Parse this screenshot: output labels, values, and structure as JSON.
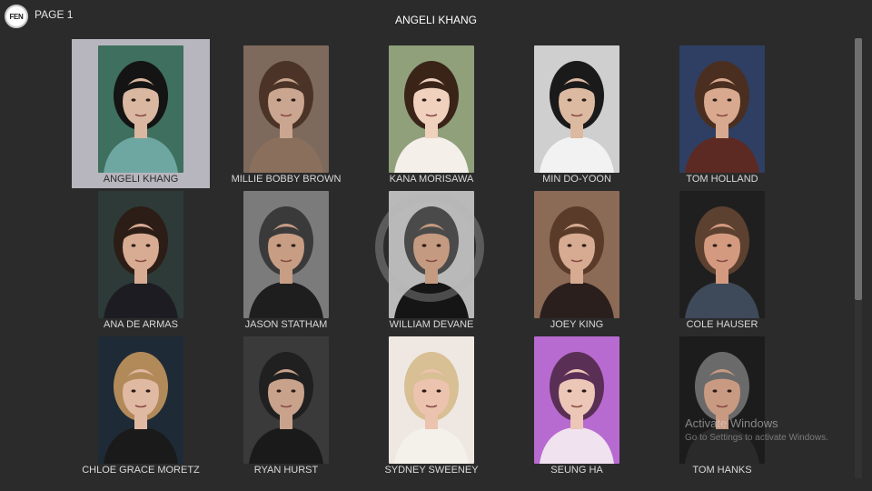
{
  "app": {
    "logo_text": "FEN",
    "page_label": "PAGE 1"
  },
  "header": {
    "title": "ANGELI KHANG"
  },
  "grid": {
    "selected_index": 0,
    "items": [
      {
        "name": "ANGELI KHANG",
        "bg": "#3f6f5e",
        "skin": "#d9b7a0",
        "hair": "#141414",
        "shirt": "#6ea7a2"
      },
      {
        "name": "MILLIE BOBBY BROWN",
        "bg": "#7d6a5c",
        "skin": "#caa58f",
        "hair": "#4b3427",
        "shirt": "#8a6f5d"
      },
      {
        "name": "KANA MORISAWA",
        "bg": "#8fa07a",
        "skin": "#f0d1be",
        "hair": "#3a2418",
        "shirt": "#f4efe9"
      },
      {
        "name": "MIN DO-YOON",
        "bg": "#cfcfcf",
        "skin": "#dcb9a1",
        "hair": "#1a1a1a",
        "shirt": "#f2f2f2"
      },
      {
        "name": "TOM HOLLAND",
        "bg": "#2f3f63",
        "skin": "#d8a98e",
        "hair": "#4a2e20",
        "shirt": "#5c2a22"
      },
      {
        "name": "ANA DE ARMAS",
        "bg": "#2d3a38",
        "skin": "#d8ab93",
        "hair": "#2c1d16",
        "shirt": "#1c1c22"
      },
      {
        "name": "JASON STATHAM",
        "bg": "#7b7b7b",
        "skin": "#c79d84",
        "hair": "#3a3a3a",
        "shirt": "#1e1e1e"
      },
      {
        "name": "WILLIAM DEVANE",
        "bg": "#b9b9b9",
        "skin": "#c49a80",
        "hair": "#4a4a4a",
        "shirt": "#151515"
      },
      {
        "name": "JOEY KING",
        "bg": "#8b6a56",
        "skin": "#d6ab92",
        "hair": "#5a3b2a",
        "shirt": "#2b1f1d"
      },
      {
        "name": "COLE HAUSER",
        "bg": "#1f1f1f",
        "skin": "#d49a80",
        "hair": "#5c4030",
        "shirt": "#3e4a5a"
      },
      {
        "name": "CHLOE GRACE MORETZ",
        "bg": "#1e2a36",
        "skin": "#e0b9a3",
        "hair": "#b28a5a",
        "shirt": "#1a1a1a"
      },
      {
        "name": "RYAN HURST",
        "bg": "#3a3a3a",
        "skin": "#c9a28c",
        "hair": "#202020",
        "shirt": "#1a1a1a"
      },
      {
        "name": "SYDNEY SWEENEY",
        "bg": "#efe8e2",
        "skin": "#ecc3ae",
        "hair": "#d8bf94",
        "shirt": "#f4f0ea"
      },
      {
        "name": "SEUNG HA",
        "bg": "#b76bd0",
        "skin": "#ecc6b6",
        "hair": "#5a2f55",
        "shirt": "#f0e2ef"
      },
      {
        "name": "TOM HANKS",
        "bg": "#1c1c1c",
        "skin": "#c99a82",
        "hair": "#6a6a6a",
        "shirt": "#2a2a2a"
      }
    ]
  },
  "watermark": {
    "title": "Activate Windows",
    "subtitle": "Go to Settings to activate Windows."
  },
  "colors": {
    "background": "#2b2b2b",
    "selected_bg": "#b7b6be",
    "name_text": "#d9d9d9"
  }
}
